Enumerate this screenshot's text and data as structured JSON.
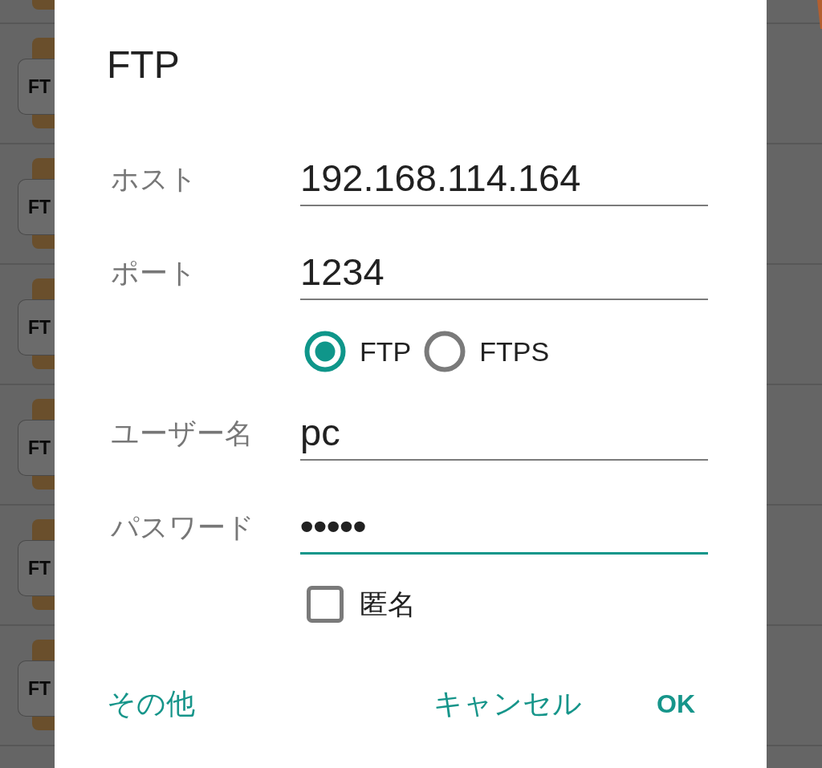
{
  "background_list": {
    "rows": [
      {
        "icon_label": "FT"
      },
      {
        "icon_label": "FT"
      },
      {
        "icon_label": "FT"
      },
      {
        "icon_label": "FT"
      },
      {
        "icon_label": "FT"
      },
      {
        "icon_label": "FT"
      }
    ]
  },
  "dialog": {
    "title": "FTP",
    "fields": [
      {
        "kind": "text",
        "label": "ホスト",
        "value": "192.168.114.164",
        "focused": false
      },
      {
        "kind": "text",
        "label": "ポート",
        "value": "1234",
        "focused": false
      },
      {
        "kind": "radio_group",
        "options": [
          {
            "label": "FTP",
            "selected": true
          },
          {
            "label": "FTPS",
            "selected": false
          }
        ]
      },
      {
        "kind": "text",
        "label": "ユーザー名",
        "value": "pc",
        "focused": false
      },
      {
        "kind": "password",
        "label": "パスワード",
        "value": "•••••",
        "focused": true
      },
      {
        "kind": "checkbox",
        "label": "匿名",
        "checked": false
      }
    ],
    "buttons": [
      {
        "kind": "neutral",
        "label": "その他"
      },
      {
        "kind": "negative",
        "label": "キャンセル"
      },
      {
        "kind": "positive",
        "label": "OK"
      }
    ]
  }
}
